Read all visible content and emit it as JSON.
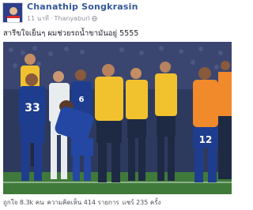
{
  "post": {
    "author": "Chanathip Songkrasin",
    "time": "11 นาที",
    "location": "Thanyaburi",
    "caption": "สารีขใจเย็นๆ ผมช่วยรถน้ำขามันอยู่ 5555",
    "photo_numbers": [
      "33",
      "6",
      "12"
    ],
    "stats": {
      "likes": "ถูกใจ 8.3k คน",
      "reach": "ความคิดเห็น 414 รายการ",
      "shares": "แชร์ 235 ครั้ง"
    }
  },
  "colors": {
    "author": "#365899",
    "meta": "#90949c",
    "thai_blue_kit": "#1f3d8f",
    "yellow_shirt": "#f2c12e",
    "orange_bib": "#f08a2b",
    "pitch": "#3f7a3a"
  },
  "icons": [
    "globe-icon"
  ]
}
